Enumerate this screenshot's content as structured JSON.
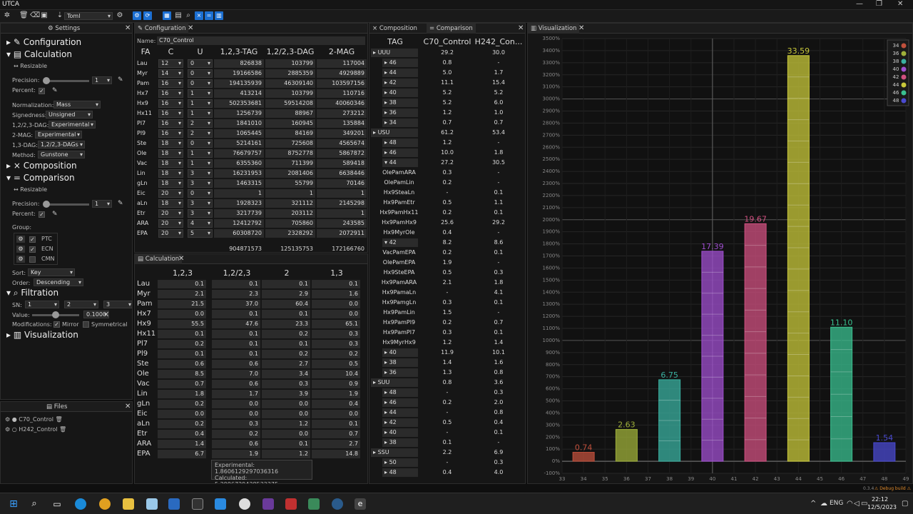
{
  "app": {
    "title": "UTCA",
    "toml_label": "Toml"
  },
  "settings": {
    "tab": "Settings",
    "configuration": "Configuration",
    "calculation": "Calculation",
    "resizable": "Resizable",
    "precision_label": "Precision:",
    "precision_value": "1",
    "percent_label": "Percent:",
    "normalization_label": "Normalization:",
    "normalization": "Mass",
    "signedness_label": "Signedness:",
    "signedness": "Unsigned",
    "dag123_label": "1,2/2,3-DAG:",
    "dag123": "Experimental",
    "mag2_label": "2-MAG:",
    "mag2": "Experimental",
    "dag13_label": "1,3-DAG:",
    "dag13": "1,2/2,3-DAGs",
    "method_label": "Method:",
    "method": "Gunstone",
    "composition": "Composition",
    "comparison": "Comparison",
    "precision2_value": "1",
    "group_label": "Group:",
    "groups": [
      "PTC",
      "ECN",
      "CMN"
    ],
    "sort_label": "Sort:",
    "sort": "Key",
    "order_label": "Order:",
    "order": "Descending",
    "filtration": "Filtration",
    "sn_label": "SN:",
    "sn": [
      "1",
      "2",
      "3"
    ],
    "value_label": "Value:",
    "value": "0.10000",
    "modifications_label": "Modifications:",
    "mirror": "Mirror",
    "symmetrical": "Symmetrical",
    "visualization": "Visualization"
  },
  "files": {
    "title": "Files",
    "items": [
      "C70_Control",
      "H242_Control"
    ]
  },
  "configuration": {
    "tab": "Configuration",
    "name_label": "Name:",
    "name": "C70_Control",
    "headers": [
      "FA",
      "C",
      "U",
      "1,2,3-TAG",
      "1,2/2,3-DAG",
      "2-MAG"
    ],
    "rows": [
      [
        "Lau",
        "12",
        "0",
        "826838",
        "103799",
        "117004"
      ],
      [
        "Myr",
        "14",
        "0",
        "19166586",
        "2885359",
        "4929889"
      ],
      [
        "Pam",
        "16",
        "0",
        "194135939",
        "46309140",
        "103597156"
      ],
      [
        "Hx7",
        "16",
        "1",
        "413214",
        "103799",
        "110716"
      ],
      [
        "Hx9",
        "16",
        "1",
        "502353681",
        "59514208",
        "40060346"
      ],
      [
        "Hx11",
        "16",
        "1",
        "1256739",
        "88967",
        "273212"
      ],
      [
        "Pl7",
        "16",
        "2",
        "1841010",
        "160945",
        "135884"
      ],
      [
        "Pl9",
        "16",
        "2",
        "1065445",
        "84169",
        "349201"
      ],
      [
        "Ste",
        "18",
        "0",
        "5214161",
        "725608",
        "4565674"
      ],
      [
        "Ole",
        "18",
        "1",
        "76679757",
        "8752778",
        "5867872"
      ],
      [
        "Vac",
        "18",
        "1",
        "6355360",
        "711399",
        "589418"
      ],
      [
        "Lin",
        "18",
        "3",
        "16231953",
        "2081406",
        "6638446"
      ],
      [
        "gLn",
        "18",
        "3",
        "1463315",
        "55799",
        "70146"
      ],
      [
        "Eic",
        "20",
        "0",
        "1",
        "1",
        "1"
      ],
      [
        "aLn",
        "18",
        "3",
        "1928323",
        "321112",
        "2145298"
      ],
      [
        "Etr",
        "20",
        "3",
        "3217739",
        "203112",
        "1"
      ],
      [
        "ARA",
        "20",
        "4",
        "12412792",
        "705860",
        "243585"
      ],
      [
        "EPA",
        "20",
        "5",
        "60308720",
        "2328292",
        "2072911"
      ]
    ],
    "totals": [
      "904871573",
      "125135753",
      "172166760"
    ]
  },
  "calculation": {
    "tab": "Calculation",
    "headers": [
      "1,2,3",
      "1,2/2,3",
      "2",
      "1,3"
    ],
    "rows": [
      [
        "Lau",
        "0.1",
        "0.1",
        "0.1",
        "0.1"
      ],
      [
        "Myr",
        "2.1",
        "2.3",
        "2.9",
        "1.6"
      ],
      [
        "Pam",
        "21.5",
        "37.0",
        "60.4",
        "0.0"
      ],
      [
        "Hx7",
        "0.0",
        "0.1",
        "0.1",
        "0.0"
      ],
      [
        "Hx9",
        "55.5",
        "47.6",
        "23.3",
        "65.1"
      ],
      [
        "Hx11",
        "0.1",
        "0.1",
        "0.2",
        "0.3"
      ],
      [
        "Pl7",
        "0.2",
        "0.1",
        "0.1",
        "0.3"
      ],
      [
        "Pl9",
        "0.1",
        "0.1",
        "0.2",
        "0.2"
      ],
      [
        "Ste",
        "0.6",
        "0.6",
        "2.7",
        "0.5"
      ],
      [
        "Ole",
        "8.5",
        "7.0",
        "3.4",
        "10.4"
      ],
      [
        "Vac",
        "0.7",
        "0.6",
        "0.3",
        "0.9"
      ],
      [
        "Lin",
        "1.8",
        "1.7",
        "3.9",
        "1.9"
      ],
      [
        "gLn",
        "0.2",
        "0.0",
        "0.0",
        "0.4"
      ],
      [
        "Eic",
        "0.0",
        "0.0",
        "0.0",
        "0.0"
      ],
      [
        "aLn",
        "0.2",
        "0.3",
        "1.2",
        "0.1"
      ],
      [
        "Etr",
        "0.4",
        "0.2",
        "0.0",
        "0.7"
      ],
      [
        "ARA",
        "1.4",
        "0.6",
        "0.1",
        "2.7"
      ],
      [
        "EPA",
        "6.7",
        "1.9",
        "1.2",
        "14.8"
      ]
    ],
    "tooltip": [
      "Experimental: 1.8606129297036316",
      "Calculated: 5.2996729438532375"
    ]
  },
  "comparison": {
    "tabs": [
      "Composition",
      "Comparison"
    ],
    "headers": [
      "TAG",
      "C70_Control",
      "H242_Con..."
    ],
    "rows": [
      {
        "l": "UUU",
        "k": "g",
        "a": "29.2",
        "b": "30.0"
      },
      {
        "l": "46",
        "k": "s",
        "a": "0.8",
        "b": "-"
      },
      {
        "l": "44",
        "k": "s",
        "a": "5.0",
        "b": "1.7"
      },
      {
        "l": "42",
        "k": "s",
        "a": "11.1",
        "b": "15.4"
      },
      {
        "l": "40",
        "k": "s",
        "a": "5.2",
        "b": "5.2"
      },
      {
        "l": "38",
        "k": "s",
        "a": "5.2",
        "b": "6.0"
      },
      {
        "l": "36",
        "k": "s",
        "a": "1.2",
        "b": "1.0"
      },
      {
        "l": "34",
        "k": "s",
        "a": "0.7",
        "b": "0.7"
      },
      {
        "l": "USU",
        "k": "g",
        "a": "61.2",
        "b": "53.4"
      },
      {
        "l": "48",
        "k": "s",
        "a": "1.2",
        "b": "-"
      },
      {
        "l": "46",
        "k": "s",
        "a": "10.0",
        "b": "1.8"
      },
      {
        "l": "44",
        "k": "o",
        "a": "27.2",
        "b": "30.5"
      },
      {
        "l": "OlePamARA",
        "k": "t",
        "a": "0.3",
        "b": "-"
      },
      {
        "l": "OlePamLin",
        "k": "t",
        "a": "0.2",
        "b": "-"
      },
      {
        "l": "Hx9SteaLn",
        "k": "t",
        "a": "-",
        "b": "0.1"
      },
      {
        "l": "Hx9PamEtr",
        "k": "t",
        "a": "0.5",
        "b": "1.1"
      },
      {
        "l": "Hx9PamHx11",
        "k": "t",
        "a": "0.2",
        "b": "0.1"
      },
      {
        "l": "Hx9PamHx9",
        "k": "t",
        "a": "25.6",
        "b": "29.2"
      },
      {
        "l": "Hx9MyrOle",
        "k": "t",
        "a": "0.4",
        "b": "-"
      },
      {
        "l": "42",
        "k": "o",
        "a": "8.2",
        "b": "8.6"
      },
      {
        "l": "VacPamEPA",
        "k": "t",
        "a": "0.2",
        "b": "0.1"
      },
      {
        "l": "OlePamEPA",
        "k": "t",
        "a": "1.9",
        "b": "-"
      },
      {
        "l": "Hx9SteEPA",
        "k": "t",
        "a": "0.5",
        "b": "0.3"
      },
      {
        "l": "Hx9PamARA",
        "k": "t",
        "a": "2.1",
        "b": "1.8"
      },
      {
        "l": "Hx9PamaLn",
        "k": "t",
        "a": "-",
        "b": "4.1"
      },
      {
        "l": "Hx9PamgLn",
        "k": "t",
        "a": "0.3",
        "b": "0.1"
      },
      {
        "l": "Hx9PamLin",
        "k": "t",
        "a": "1.5",
        "b": "-"
      },
      {
        "l": "Hx9PamPl9",
        "k": "t",
        "a": "0.2",
        "b": "0.7"
      },
      {
        "l": "Hx9PamPl7",
        "k": "t",
        "a": "0.3",
        "b": "0.1"
      },
      {
        "l": "Hx9MyrHx9",
        "k": "t",
        "a": "1.2",
        "b": "1.4"
      },
      {
        "l": "40",
        "k": "s",
        "a": "11.9",
        "b": "10.1"
      },
      {
        "l": "38",
        "k": "s",
        "a": "1.4",
        "b": "1.6"
      },
      {
        "l": "36",
        "k": "s",
        "a": "1.3",
        "b": "0.8"
      },
      {
        "l": "SUU",
        "k": "g",
        "a": "0.8",
        "b": "3.6"
      },
      {
        "l": "48",
        "k": "s",
        "a": "-",
        "b": "0.3"
      },
      {
        "l": "46",
        "k": "s",
        "a": "0.2",
        "b": "2.0"
      },
      {
        "l": "44",
        "k": "s",
        "a": "-",
        "b": "0.8"
      },
      {
        "l": "42",
        "k": "s",
        "a": "0.5",
        "b": "0.4"
      },
      {
        "l": "40",
        "k": "s",
        "a": "-",
        "b": "0.1"
      },
      {
        "l": "38",
        "k": "s",
        "a": "0.1",
        "b": "-"
      },
      {
        "l": "SSU",
        "k": "g",
        "a": "2.2",
        "b": "6.9"
      },
      {
        "l": "50",
        "k": "s",
        "a": "-",
        "b": "0.3"
      },
      {
        "l": "48",
        "k": "s",
        "a": "0.4",
        "b": "4.0"
      }
    ]
  },
  "visualization": {
    "tab": "Visualization"
  },
  "chart_data": {
    "type": "bar",
    "x": [
      34,
      36,
      38,
      40,
      42,
      44,
      46,
      48
    ],
    "values": [
      0.74,
      2.63,
      6.75,
      17.39,
      19.67,
      33.59,
      11.1,
      1.54
    ],
    "labels": [
      "0.74",
      "2.63",
      "6.75",
      "17.39",
      "19.67",
      "33.59",
      "11.10",
      "1.54"
    ],
    "colors": [
      "#c0503c",
      "#9fb03a",
      "#3ab0a0",
      "#a04fd0",
      "#d05080",
      "#c8c83a",
      "#3ac090",
      "#4a4ad0"
    ],
    "legend": [
      "34",
      "36",
      "38",
      "40",
      "42",
      "44",
      "46",
      "48"
    ],
    "xticks": [
      "33",
      "34",
      "35",
      "36",
      "37",
      "38",
      "39",
      "40",
      "41",
      "42",
      "43",
      "44",
      "45",
      "46",
      "47",
      "48",
      "49"
    ],
    "yticks": [
      "-100%",
      "0%",
      "100%",
      "200%",
      "300%",
      "400%",
      "500%",
      "600%",
      "700%",
      "800%",
      "900%",
      "1000%",
      "1100%",
      "1200%",
      "1300%",
      "1400%",
      "1500%",
      "1600%",
      "1700%",
      "1800%",
      "1900%",
      "2000%",
      "2100%",
      "2200%",
      "2300%",
      "2400%",
      "2500%",
      "2600%",
      "2700%",
      "2800%",
      "2900%",
      "3000%",
      "3100%",
      "3200%",
      "3300%",
      "3400%",
      "3500%"
    ],
    "ylim": [
      -100,
      3500
    ],
    "xlim": [
      33,
      49
    ],
    "legend_position": "top-right"
  },
  "status": {
    "version": "0.3.4",
    "debug": "⚠ Debug build ⚠"
  },
  "taskbar": {
    "lang": "ENG",
    "time": "22:12",
    "date": "12/5/2023"
  }
}
